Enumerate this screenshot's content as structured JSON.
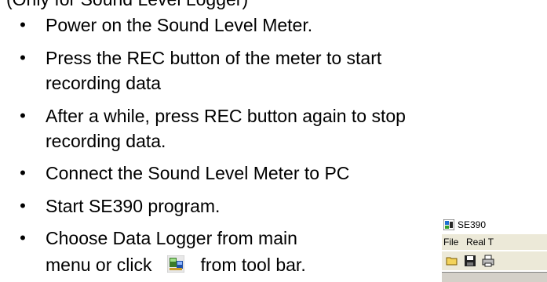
{
  "header_fragment": "(Only for Sound Level Logger)",
  "steps": [
    {
      "text": "Power on the Sound Level Meter."
    },
    {
      "text": "Press the REC button of the meter to start",
      "continuation": "recording data"
    },
    {
      "text": "After a while, press REC button again to stop",
      "continuation": "recording data."
    },
    {
      "text": "Connect the Sound Level Meter to PC"
    },
    {
      "text": "Start SE390 program."
    },
    {
      "text": "Choose Data Logger from main",
      "continuation_before_icon": "menu or click",
      "continuation_after_icon": "from tool bar.",
      "icon": "data-logger-icon"
    }
  ],
  "app_window": {
    "title": "SE390",
    "title_icon": "app-icon",
    "menu": [
      "File",
      "Real T"
    ],
    "toolbar": [
      "open-folder-icon",
      "save-disk-icon",
      "print-icon"
    ]
  },
  "colors": {
    "text": "#000000",
    "background": "#ffffff",
    "toolbar_bg": "#ece9d8"
  }
}
